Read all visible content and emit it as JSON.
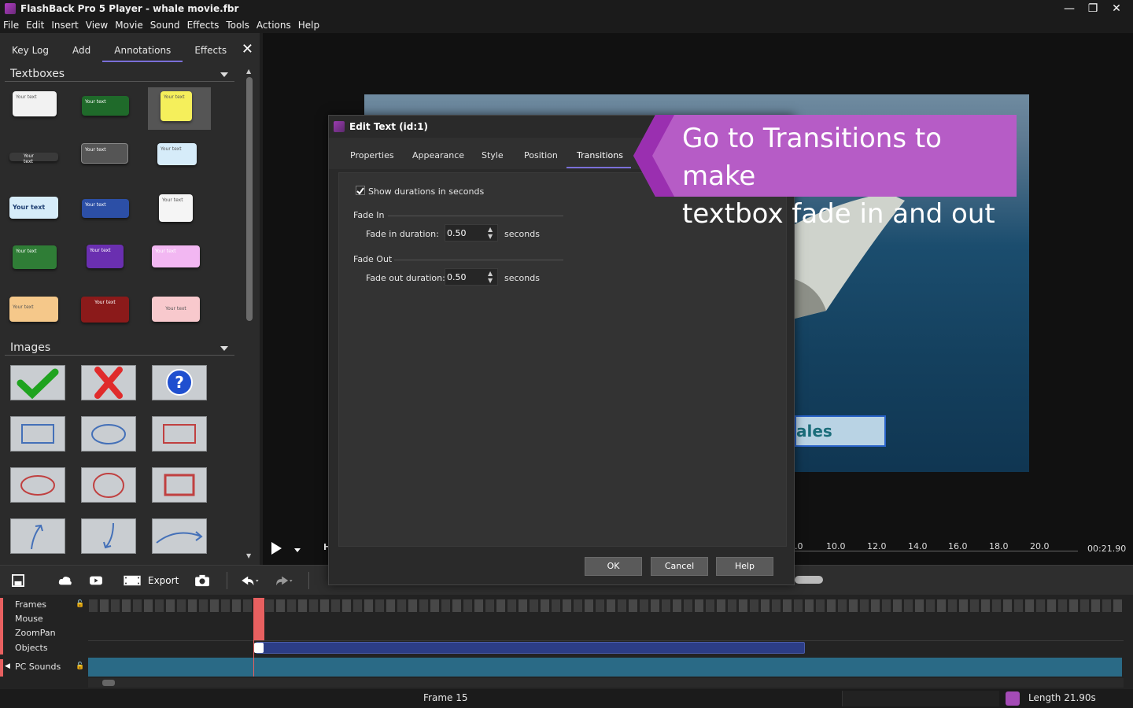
{
  "window": {
    "title": "FlashBack Pro 5 Player - whale movie.fbr",
    "controls": [
      "—",
      "❐",
      "✕"
    ]
  },
  "menu": [
    "File",
    "Edit",
    "Insert",
    "View",
    "Movie",
    "Sound",
    "Effects",
    "Tools",
    "Actions",
    "Help"
  ],
  "left_panel": {
    "tabs": [
      "Key Log",
      "Add",
      "Annotations",
      "Effects"
    ],
    "active_tab": "Annotations",
    "textboxes_header": "Textboxes",
    "images_header": "Images",
    "textbox_sample": "Your text",
    "textbox_sample_large": "Your text"
  },
  "preview": {
    "video_text": "ales",
    "ruler_labels": [
      ".0",
      "10.0",
      "12.0",
      "14.0",
      "16.0",
      "18.0",
      "20.0"
    ],
    "total_time": "00:21.90"
  },
  "toolbar": {
    "export_label": "Export"
  },
  "timeline": {
    "tracks": [
      "Frames",
      "Mouse",
      "ZoomPan",
      "Objects",
      "PC Sounds"
    ]
  },
  "status": {
    "frame": "Frame 15",
    "length": "Length 21.90s"
  },
  "dialog": {
    "title": "Edit Text (id:1)",
    "tabs": [
      "Properties",
      "Appearance",
      "Style",
      "Position",
      "Transitions"
    ],
    "active_tab": "Transitions",
    "show_durations_label": "Show durations in seconds",
    "show_durations_checked": true,
    "fade_in_group": "Fade In",
    "fade_in_label": "Fade in duration:",
    "fade_in_value": "0.50",
    "fade_out_group": "Fade Out",
    "fade_out_label": "Fade out duration:",
    "fade_out_value": "0.50",
    "unit_label": "seconds",
    "ok": "OK",
    "cancel": "Cancel",
    "help": "Help"
  },
  "callout": {
    "text_line1": "Go to Transitions to make",
    "text_line2": "textbox fade in and out",
    "color": "#b65cc6"
  }
}
